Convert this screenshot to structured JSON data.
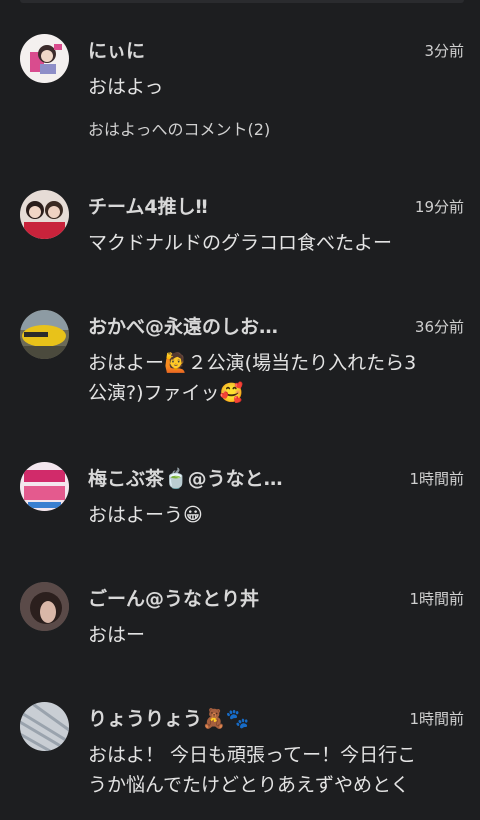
{
  "posts": [
    {
      "name": "にぃに",
      "time": "3分前",
      "body": "おはよっ",
      "comments": "おはよっへのコメント(2)"
    },
    {
      "name": "チーム4推し‼",
      "time": "19分前",
      "body": "マクドナルドのグラコロ食べたよー"
    },
    {
      "name": "おかべ@永遠のしお…",
      "time": "36分前",
      "body_line1": "おはよー🙋２公演(場当たり入れたら3",
      "body_line2": "公演?)ファイッ🥰"
    },
    {
      "name": "梅こぶ茶🍵@うなと…",
      "time": "1時間前",
      "body": "おはよーう😀"
    },
    {
      "name": "ごーん@うなとり丼",
      "time": "1時間前",
      "body": "おはー"
    },
    {
      "name": "りょうりょう🧸🐾",
      "time": "1時間前",
      "body_line1": "おはよ！ 今日も頑張ってー！今日行こ",
      "body_line2": "うか悩んでたけどとりあえずやめとく"
    }
  ]
}
